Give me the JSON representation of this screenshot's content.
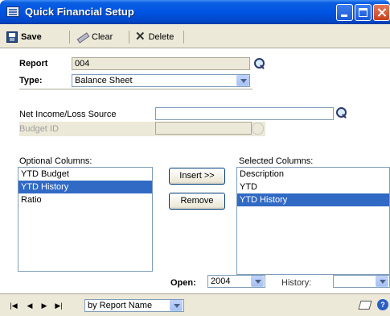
{
  "window": {
    "title": "Quick Financial Setup"
  },
  "toolbar": {
    "save_label": "Save",
    "clear_label": "Clear",
    "delete_label": "Delete"
  },
  "form": {
    "report_label": "Report",
    "report_value": "004",
    "type_label": "Type:",
    "type_value": "Balance Sheet",
    "net_income_label": "Net Income/Loss Source",
    "net_income_value": "",
    "budget_id_label": "Budget ID",
    "optional_columns_label": "Optional Columns:",
    "optional_columns": [
      "YTD Budget",
      "YTD History",
      "Ratio"
    ],
    "optional_selected_index": 1,
    "selected_columns_label": "Selected Columns:",
    "selected_columns": [
      "Description",
      "YTD",
      "YTD History"
    ],
    "selected_selected_index": 2,
    "insert_label": "Insert >>",
    "remove_label": "Remove",
    "open_label": "Open:",
    "open_value": "2004",
    "history_label": "History:",
    "history_value": ""
  },
  "statusbar": {
    "sort_value": "by Report Name"
  }
}
